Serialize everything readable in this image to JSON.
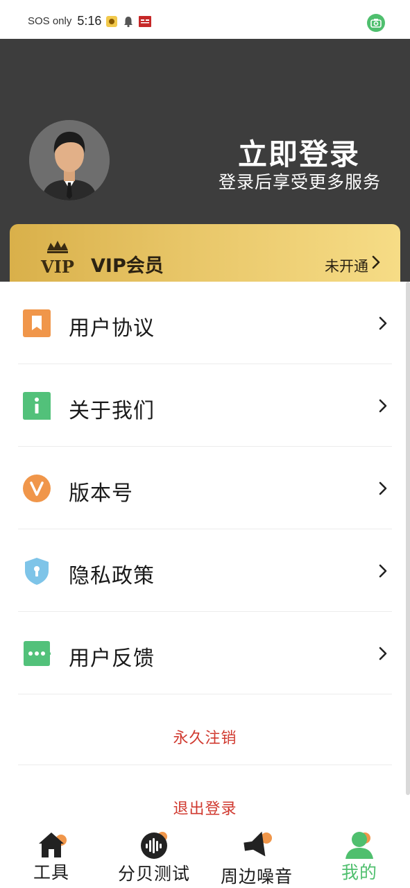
{
  "status_bar": {
    "carrier": "SOS only",
    "time": "5:16"
  },
  "header": {
    "login_title": "立即登录",
    "login_subtitle": "登录后享受更多服务"
  },
  "vip": {
    "title": "VIP会员",
    "status": "未开通",
    "logo_text": "VIP"
  },
  "menu": {
    "items": [
      {
        "label": "用户协议",
        "icon": "bookmark-icon",
        "color": "#f0964a"
      },
      {
        "label": "关于我们",
        "icon": "info-icon",
        "color": "#52c17a"
      },
      {
        "label": "版本号",
        "icon": "version-v-icon",
        "color": "#f0964a"
      },
      {
        "label": "隐私政策",
        "icon": "shield-icon",
        "color": "#7ec4e8"
      },
      {
        "label": "用户反馈",
        "icon": "chat-bubble-icon",
        "color": "#52c17a"
      }
    ],
    "delete_account": "永久注销",
    "logout": "退出登录"
  },
  "bottom_nav": {
    "items": [
      {
        "label": "工具",
        "icon": "house-icon",
        "active": false
      },
      {
        "label": "分贝测试",
        "icon": "sound-wave-icon",
        "active": false
      },
      {
        "label": "周边噪音",
        "icon": "speaker-icon",
        "active": false
      },
      {
        "label": "我的",
        "icon": "person-icon",
        "active": true
      }
    ]
  },
  "colors": {
    "header_bg": "#3d3d3d",
    "accent_green": "#4fbf6e",
    "danger_red": "#d0392f",
    "vip_gold": "#e8c668",
    "badge_orange": "#f0964a"
  }
}
